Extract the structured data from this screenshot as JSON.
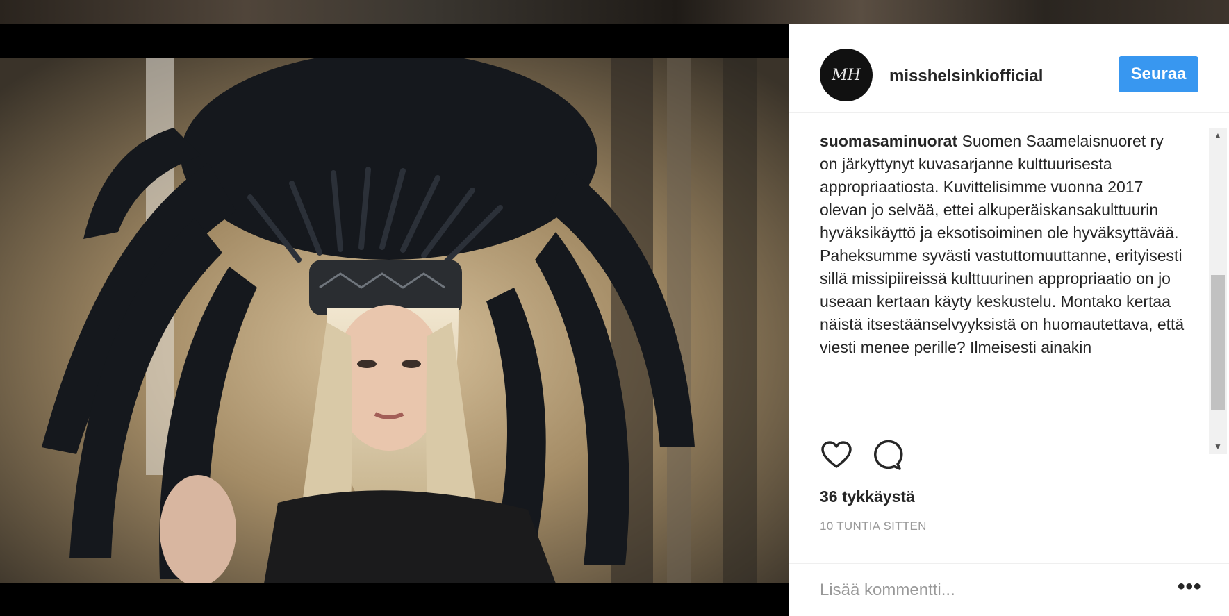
{
  "post": {
    "username": "misshelsinkiofficial",
    "avatar_monogram": "MH",
    "follow_label": "Seuraa",
    "caption_author": "suomasaminuorat",
    "caption_text": " Suomen Saamelaisnuoret ry on järkyttynyt kuvasarjanne kulttuurisesta appropriaatiosta. Kuvittelisimme vuonna 2017 olevan jo selvää, ettei alkuperäiskansakulttuurin hyväksikäyttö ja eksotisoiminen ole hyväksyttävää. Paheksumme syvästi vastuttomuuttanne, erityisesti sillä missipiireissä kulttuurinen appropriaatio on jo useaan kertaan käyty keskustelu. Montako kertaa näistä itsestäänselvyyksistä on huomautettava, että viesti menee perille? Ilmeisesti ainakin",
    "likes": "36 tykkäystä",
    "time_ago": "10 TUNTIA SITTEN",
    "comment_placeholder": "Lisää kommentti...",
    "more_icon": "•••"
  },
  "icons": {
    "like": "heart-icon",
    "comment": "speech-bubble-icon",
    "scroll_up": "▲",
    "scroll_down": "▼"
  },
  "colors": {
    "follow_button": "#3897f0",
    "text": "#262626",
    "muted": "#999999"
  }
}
